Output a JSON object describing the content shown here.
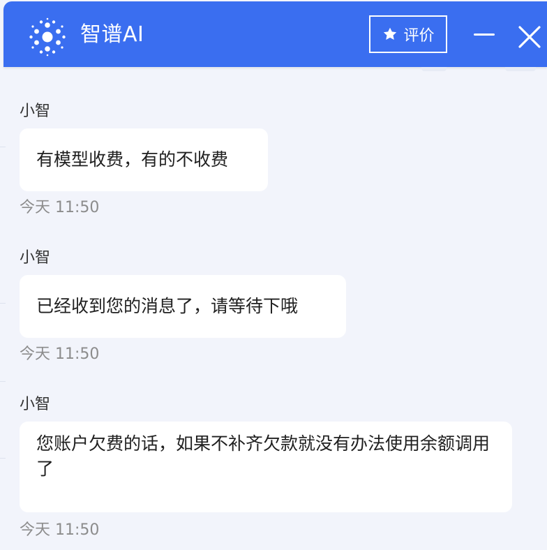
{
  "header": {
    "app_title": "智谱AI",
    "rate_label": "评价",
    "logo_icon": "spark-dots-logo",
    "rate_icon": "star-icon",
    "minimize_icon": "minimize-icon",
    "close_icon": "close-icon"
  },
  "messages": [
    {
      "sender": "小智",
      "text": "有模型收费，有的不收费",
      "time": "今天 11:50"
    },
    {
      "sender": "小智",
      "text": "已经收到您的消息了，请等待下哦",
      "time": "今天 11:50"
    },
    {
      "sender": "小智",
      "text": "您账户欠费的话，如果不补齐欠款就没有办法使用余额调用了",
      "time": "今天 11:50"
    }
  ],
  "colors": {
    "brand_blue": "#3a6ef0",
    "chat_background": "#f2f4fb",
    "bubble_background": "#ffffff",
    "timestamp_gray": "#8c8c8c"
  }
}
